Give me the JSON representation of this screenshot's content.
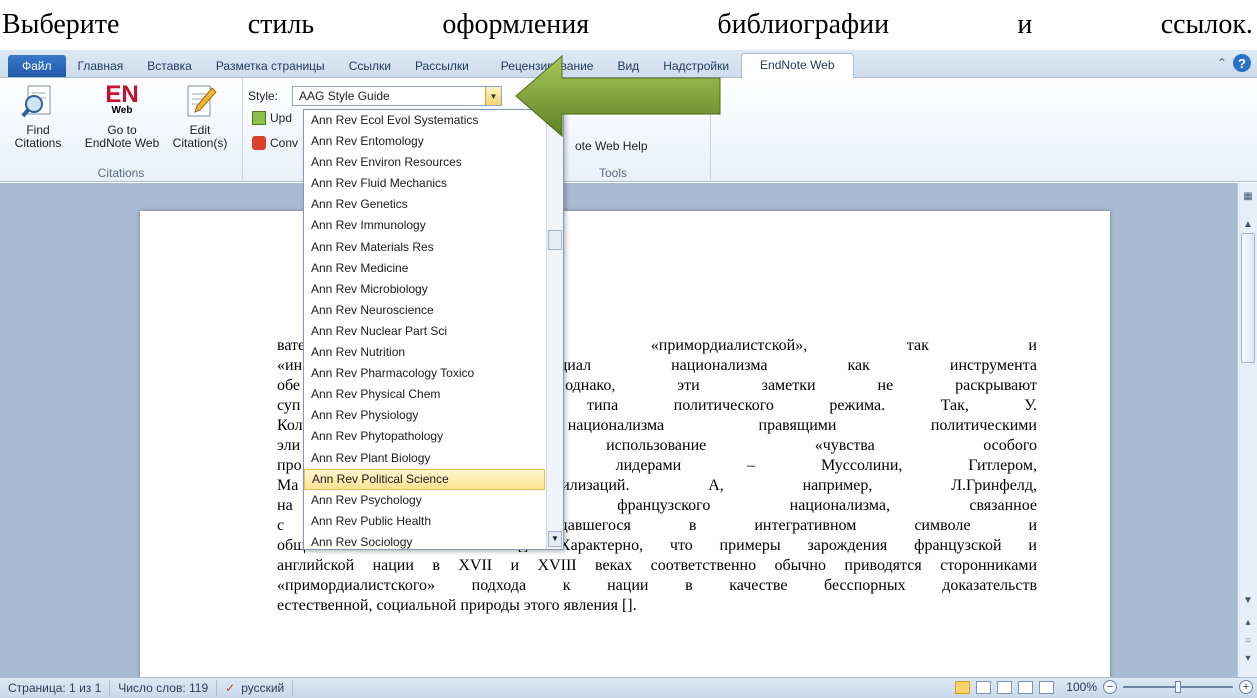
{
  "heading": {
    "words": [
      "Выберите",
      "стиль",
      "оформления",
      "библиографии",
      "и",
      "ссылок."
    ]
  },
  "ribbon_tabs": {
    "file": "Файл",
    "home": "Главная",
    "insert": "Вставка",
    "page_layout": "Разметка страницы",
    "references": "Ссылки",
    "mailings": "Рассылки",
    "review": "Рецензирование",
    "view": "Вид",
    "addins": "Надстройки",
    "endnote_web": "EndNote Web"
  },
  "ribbon": {
    "find_citations_label": "Find\nCitations",
    "goto_endnote_label": "Go to\nEndNote Web",
    "edit_citation_label": "Edit\nCitation(s)",
    "citations_group": "Citations",
    "style_label": "Style:",
    "style_value": "AAG Style Guide",
    "update_label": "Upd",
    "convert_label": "Conv",
    "help_label": "ote Web Help",
    "tools_group": "Tools",
    "en_logo_text": "EN",
    "en_logo_sub": "Web"
  },
  "style_dropdown": {
    "items": [
      "Ann Rev Ecol Evol Systematics",
      "Ann Rev Entomology",
      "Ann Rev Environ Resources",
      "Ann Rev Fluid Mechanics",
      "Ann Rev Genetics",
      "Ann Rev Immunology",
      "Ann Rev Materials Res",
      "Ann Rev Medicine",
      "Ann Rev Microbiology",
      "Ann Rev Neuroscience",
      "Ann Rev Nuclear Part Sci",
      "Ann Rev Nutrition",
      "Ann Rev Pharmacology Toxico",
      "Ann Rev Physical Chem",
      "Ann Rev Physiology",
      "Ann Rev Phytopathology",
      "Ann Rev Plant Biology",
      "Ann Rev Political Science",
      "Ann Rev Psychology",
      "Ann Rev Public Health",
      "Ann Rev Sociology"
    ],
    "selected": "Ann Rev Political Science"
  },
  "document": {
    "lines": [
      "ватели  –  как  «примордиалистской»,  так  и",
      "«ин                        ксируют потенциал национализма как инструмента",
      "обе                        ого  участия,  однако,  эти  заметки  не  раскрывают",
      "суп                        зи  нации  и  типа  политического  режима.  Так,  У.",
      "Кол                        ользования национализма правящими политическими",
      "эли                        эффективное    использование    «чувства    особого",
      "про                        [] тоталитарными лидерами – Муссолини, Гитлером,",
      "Ма                         литических мобилизаций. А, например, Л.Гринфелд,",
      "на                         т зарождение французского национализма, связанное",
      "с «                        сословия, нуждавшегося в интегративном символе и",
      "общем  стиле  мышления.  [].  Характерно,  что  примеры  зарождения  французской  и",
      "английской нации в XVII и XVIII веках соответственно обычно приводятся сторонниками",
      "«примордиалистского»  подхода  к  нации  в  качестве  бесспорных  доказательств",
      "естественной, социальной природы этого явления []."
    ]
  },
  "statusbar": {
    "page": "Страница: 1 из 1",
    "words": "Число слов: 119",
    "language": "русский",
    "zoom": "100%",
    "zoom_minus": "−",
    "zoom_plus": "+"
  }
}
